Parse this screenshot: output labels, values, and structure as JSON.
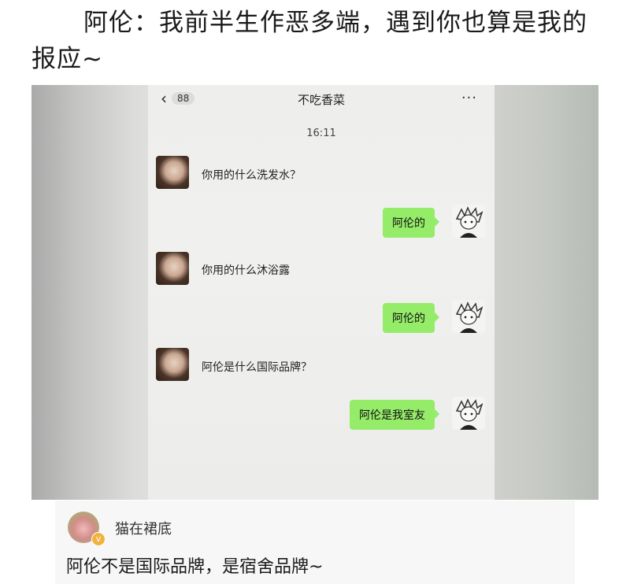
{
  "caption": "阿伦：我前半生作恶多端，遇到你也算是我的报应~",
  "chat": {
    "back_count": "88",
    "title": "不吃香菜",
    "more": "···",
    "time": "16:11",
    "messages": [
      {
        "side": "in",
        "text": "你用的什么洗发水？"
      },
      {
        "side": "out",
        "text": "阿伦的"
      },
      {
        "side": "in",
        "text": "你用的什么沐浴露"
      },
      {
        "side": "out",
        "text": "阿伦的"
      },
      {
        "side": "in",
        "text": "阿伦是什么国际品牌？"
      },
      {
        "side": "out",
        "text": "阿伦是我室友"
      }
    ]
  },
  "comment": {
    "username": "猫在裙底",
    "badge": "v",
    "text": "阿伦不是国际品牌，是宿舍品牌~"
  },
  "colors": {
    "bubble_out": "#95ec69",
    "badge": "#f2b33d"
  }
}
